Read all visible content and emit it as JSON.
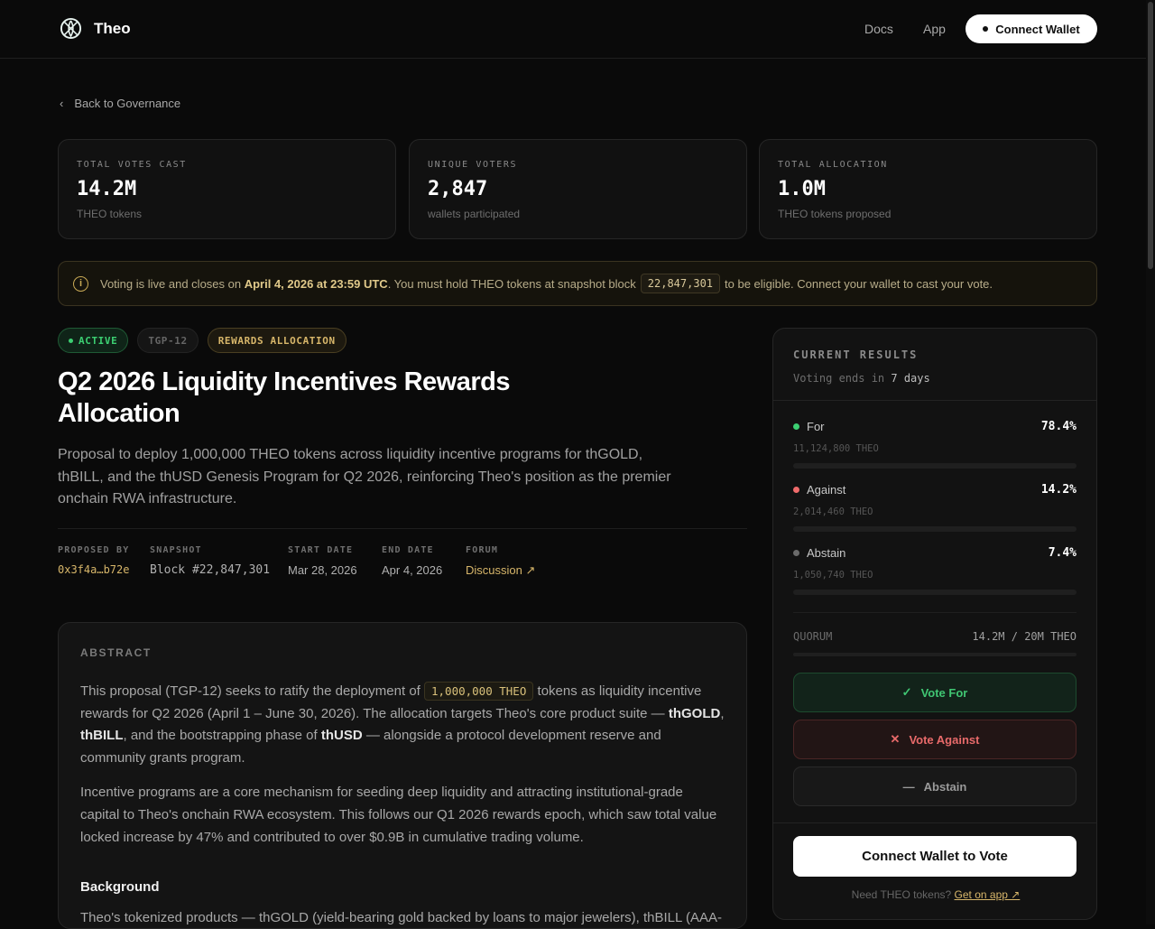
{
  "header": {
    "brand": "Theo",
    "nav": [
      "Docs",
      "App"
    ],
    "connect_label": "Connect Wallet"
  },
  "back_label": "Back to Governance",
  "stats": [
    {
      "label": "TOTAL VOTES CAST",
      "value": "14.2M",
      "sub": "THEO tokens"
    },
    {
      "label": "UNIQUE VOTERS",
      "value": "2,847",
      "sub": "wallets participated"
    },
    {
      "label": "TOTAL ALLOCATION",
      "value": "1.0M",
      "sub": "THEO tokens proposed"
    }
  ],
  "alert": {
    "t1": "Voting is live and closes on ",
    "bold": "April 4, 2026 at 23:59 UTC",
    "t2": ". You must hold THEO tokens at snapshot block",
    "block": "22,847,301",
    "t3": "to be eligible. Connect your wallet to cast your vote."
  },
  "badges": {
    "status": "ACTIVE",
    "id": "TGP-12",
    "category": "REWARDS ALLOCATION"
  },
  "title": "Q2 2026 Liquidity Incentives Rewards Allocation",
  "description": "Proposal to deploy 1,000,000 THEO tokens across liquidity incentive programs for thGOLD, thBILL, and the thUSD Genesis Program for Q2 2026, reinforcing Theo's position as the premier onchain RWA infrastructure.",
  "meta": [
    {
      "label": "PROPOSED BY",
      "value": "0x3f4a…b72e"
    },
    {
      "label": "SNAPSHOT",
      "value": "Block #22,847,301"
    },
    {
      "label": "START DATE",
      "value": "Mar 28, 2026"
    },
    {
      "label": "END DATE",
      "value": "Apr 4, 2026"
    },
    {
      "label": "FORUM",
      "value": "Discussion ↗"
    }
  ],
  "abstract": {
    "title": "ABSTRACT",
    "p1": {
      "a": "This proposal (TGP-12) seeks to ratify the deployment of ",
      "code": "1,000,000 THEO",
      "b": " tokens as liquidity incentive rewards for Q2 2026 (April 1 – June 30, 2026). The allocation targets Theo's core product suite — ",
      "thgold": "thGOLD",
      ",": ", ",
      "thbill": "thBILL",
      "c": ", and the bootstrapping phase of ",
      "thusd": "thUSD",
      "d": " — alongside a protocol development reserve and community grants program."
    },
    "p2": "Incentive programs are a core mechanism for seeding deep liquidity and attracting institutional-grade capital to Theo's onchain RWA ecosystem. This follows our Q1 2026 rewards epoch, which saw total value locked increase by 47% and contributed to over $0.9B in cumulative trading volume.",
    "h_background": "Background",
    "p3": "Theo's tokenized products — thGOLD (yield-bearing gold backed by loans to major jewelers), thBILL (AAA-"
  },
  "results": {
    "title": "CURRENT RESULTS",
    "ends_prefix": "Voting ends in ",
    "ends_value": "7 days",
    "options": [
      {
        "name": "For",
        "percent_label": "78.4%",
        "amount": "11,124,800 THEO",
        "color": "#3ccf72"
      },
      {
        "name": "Against",
        "percent_label": "14.2%",
        "amount": "2,014,460 THEO",
        "color": "#ef6b6b"
      },
      {
        "name": "Abstain",
        "percent_label": "7.4%",
        "amount": "1,050,740 THEO",
        "color": "#6a6a6a"
      }
    ],
    "quorum_label": "QUORUM",
    "quorum_value": "14.2M / 20M THEO",
    "vote_for": "Vote For",
    "vote_against": "Vote Against",
    "abstain": "Abstain",
    "connect_vote": "Connect Wallet to Vote",
    "need_text": "Need THEO tokens?",
    "get_app": "Get on app ↗"
  }
}
